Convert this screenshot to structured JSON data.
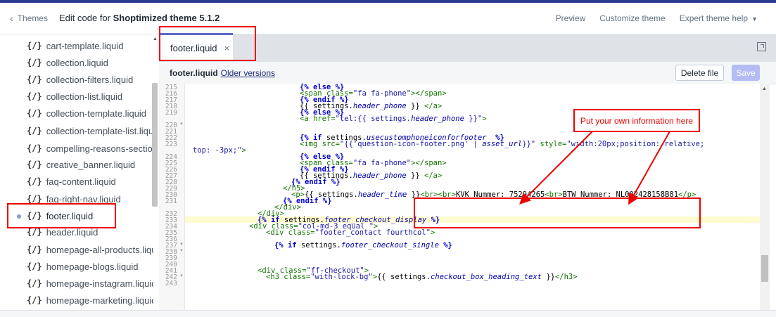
{
  "header": {
    "back_label": "Themes",
    "title_prefix": "Edit code for ",
    "theme_name": "Shoptimized theme 5.1.2",
    "actions": [
      "Preview",
      "Customize theme",
      "Expert theme help"
    ]
  },
  "sidebar": {
    "files": [
      "cart-template.liquid",
      "collection.liquid",
      "collection-filters.liquid",
      "collection-list.liquid",
      "collection-template.liquid",
      "collection-template-list.liquid",
      "compelling-reasons-section.liquid",
      "creative_banner.liquid",
      "faq-content.liquid",
      "faq-right-nav.liquid",
      "footer.liquid",
      "header.liquid",
      "homepage-all-products.liquid",
      "homepage-blogs.liquid",
      "homepage-instagram.liquid",
      "homepage-marketing.liquid"
    ],
    "brace_glyph": "{/}",
    "active_file": "footer.liquid"
  },
  "tab": {
    "label": "footer.liquid",
    "close": "×"
  },
  "filebar": {
    "filename": "footer.liquid",
    "older_versions": "Older versions"
  },
  "buttons": {
    "delete": "Delete file",
    "save": "Save"
  },
  "editor": {
    "line_numbers": [
      "215",
      "216",
      "217",
      "218",
      "219",
      "220",
      "221",
      "222",
      "223",
      "",
      "224",
      "225",
      "226",
      "227",
      "228",
      "229",
      "230",
      "231",
      "232",
      "233",
      "234",
      "235",
      "236",
      "237",
      "238",
      "239",
      "240",
      "241",
      "242",
      "243"
    ],
    "line_232_code": "{% endif %}",
    "line_231_code": "<p>{{ settings.header_time }}<br><br>KVK Nummer: 75294265<br>BTW Nummer: NL002428158B81</p>"
  },
  "annotation": {
    "text": "Put your own information here"
  },
  "colors": {
    "accent": "#5c6ac4",
    "annotation_red": "#e00000",
    "topline": "#2b3990"
  }
}
